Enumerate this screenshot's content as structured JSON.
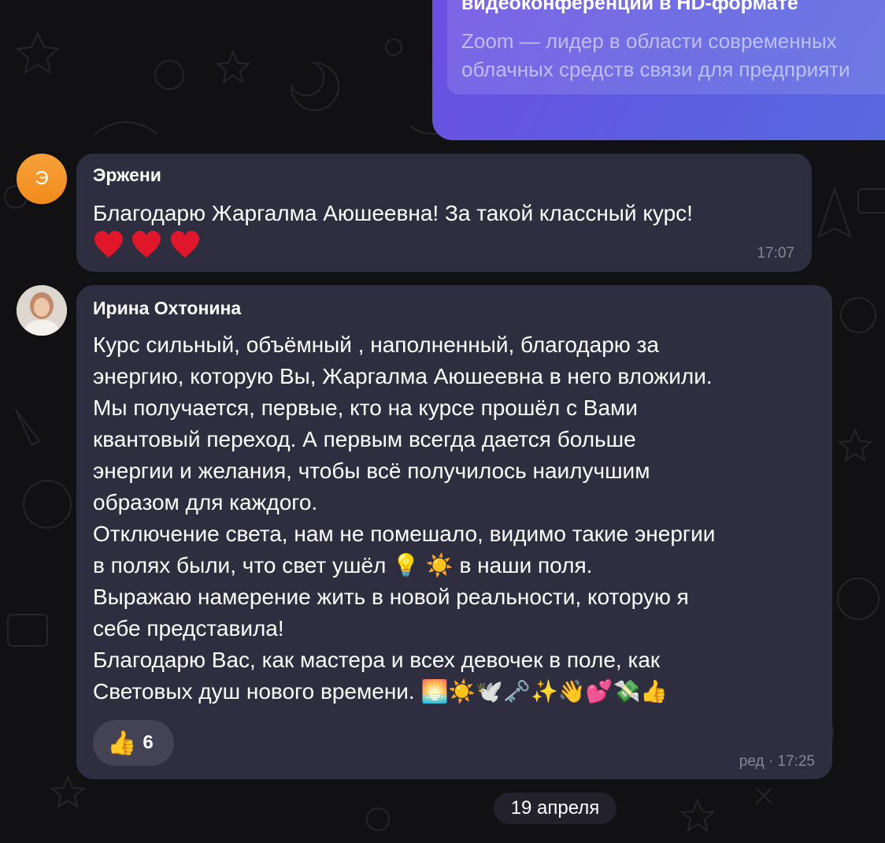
{
  "link_preview": {
    "title": "видеоконференций в HD-формате",
    "description": "Zoom — лидер в области современных\nоблачных средств связи для предприяти"
  },
  "messages": [
    {
      "sender": "Эржени",
      "avatar_letter": "Э",
      "avatar_color": "#f39423",
      "text": "Благодарю Жаргалма Аюшеевна! За такой классный курс!",
      "emoji": "❤️❤️❤️",
      "time": "17:07"
    },
    {
      "sender": "Ирина Охтонина",
      "text": "Курс сильный, объёмный , наполненный, благодарю за\nэнергию, которую Вы, Жаргалма Аюшеевна в него вложили.\nМы получается, первые, кто на курсе прошёл с Вами\nквантовый переход. А первым всегда дается больше\nэнергии и желания, чтобы всё получилось наилучшим\nобразом для каждого.\nОтключение света, нам не помешало, видимо такие энергии\nв полях были, что свет ушёл 💡 ☀️  в наши поля.\nВыражаю намерение жить в новой реальности, которую я\nсебе представила!\nБлагодарю Вас, как мастера и всех девочек в поле, как\nСветовых душ нового времени. 🌅☀️🕊️🗝️✨👋💕💸👍",
      "reaction_emoji": "👍",
      "reaction_count": "6",
      "time": "ред · 17:25"
    }
  ],
  "date_separator": "19 апреля",
  "colors": {
    "background": "#111114",
    "incoming_bubble": "#2f2e40",
    "outgoing_bubble": "#6d4ee3",
    "reaction_bg": "#444356"
  },
  "icons": {
    "reaction": "thumbs-up-icon",
    "heart": "red-heart-icon"
  }
}
